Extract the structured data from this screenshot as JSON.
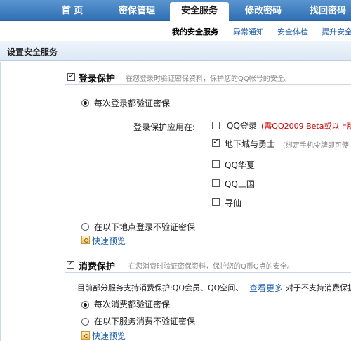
{
  "nav": {
    "tabs": [
      "首 页",
      "密保管理",
      "安全服务",
      "修改密码",
      "找回密码"
    ],
    "active_index": 2
  },
  "subnav": {
    "items": [
      "我的安全服务",
      "异常通知",
      "安全体检",
      "提升安全"
    ],
    "active_index": 0
  },
  "section": {
    "title": "设置安全服务"
  },
  "login_protect": {
    "title": "登录保护",
    "description": "在您登录时验证密保资料，保护您的QQ帐号的安全。",
    "option_always": "每次登录都验证密保",
    "apply_label": "登录保护应用在:",
    "apps": [
      {
        "name": "QQ登录",
        "note": "(需QQ2009 Beta或以上版",
        "note_style": "red",
        "checked": false
      },
      {
        "name": "地下城与勇士",
        "note": "(绑定手机令牌即可使",
        "note_style": "gray",
        "checked": true
      },
      {
        "name": "QQ华夏",
        "note": "",
        "checked": false
      },
      {
        "name": "QQ三国",
        "note": "",
        "checked": false
      },
      {
        "name": "寻仙",
        "note": "",
        "checked": false
      }
    ],
    "option_location": "在以下地点登录不验证密保",
    "preview": "快速预览"
  },
  "spend_protect": {
    "title": "消费保护",
    "description": "在您消费时验证密保资料，保护您的Q币Q点的安全。",
    "support_text": "目前部分服务支持消费保护:QQ会员、QQ空间、",
    "see_more": "查看更多",
    "unsupported": "对于不支持消费保护",
    "option_always": "每次消费都验证密保",
    "option_services": "在以下服务消费不验证密保",
    "preview": "快速预览"
  }
}
